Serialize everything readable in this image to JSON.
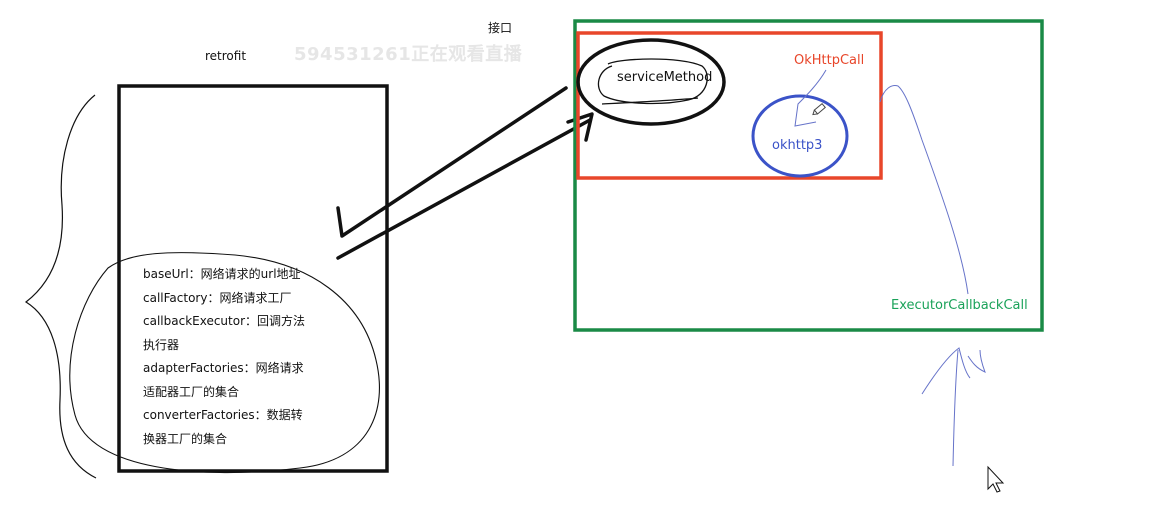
{
  "labels": {
    "retrofit": "retrofit",
    "interface": "接口",
    "watermark": "594531261正在观看直播",
    "service_method": "serviceMethod",
    "okhttp_call": "OkHttpCall",
    "okhttp3": "okhttp3",
    "executor_callback_call": "ExecutorCallbackCall"
  },
  "fields": [
    "baseUrl：网络请求的url地址",
    "callFactory：网络请求工厂",
    "callbackExecutor：回调方法",
    "执行器",
    "adapterFactories：网络请求",
    "适配器工厂的集合",
    "converterFactories：数据转",
    "换器工厂的集合"
  ],
  "colors": {
    "outer_box": "#1a8a46",
    "inner_box": "#e8462a",
    "okhttp3_circle": "#3b53c8",
    "pen_lines": "#6673c9",
    "ink": "#111111"
  },
  "icons": [
    "pencil-icon",
    "mouse-cursor-icon"
  ]
}
